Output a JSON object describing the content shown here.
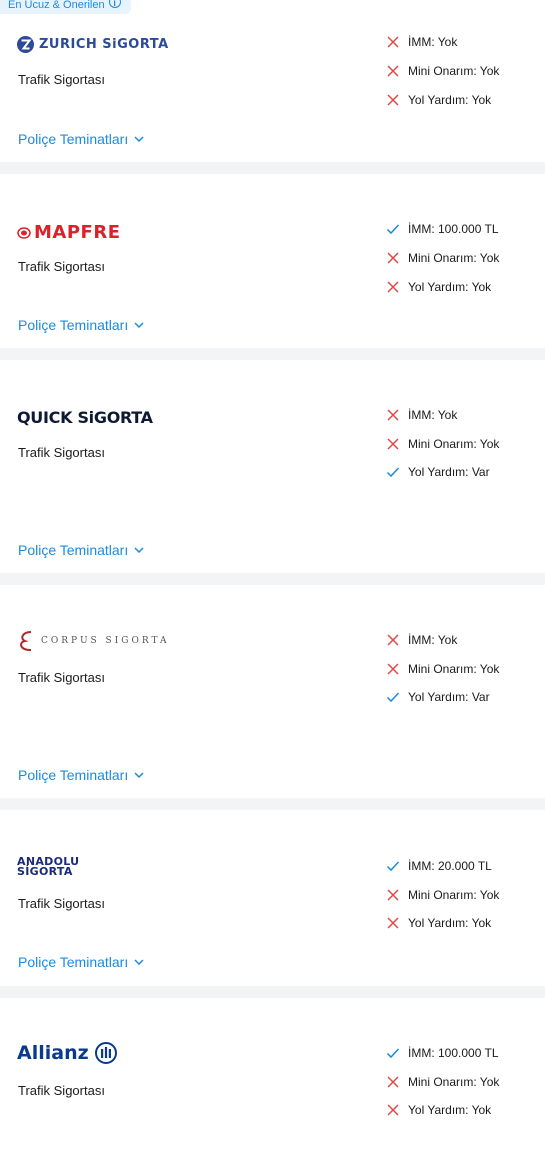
{
  "badge": {
    "label": "En Ucuz & Önerilen",
    "icon": "info-icon"
  },
  "colors": {
    "accent": "#1b8be0",
    "cross": "#e04848",
    "check": "#1b8be0",
    "separator": "#f2f4f5"
  },
  "offers": [
    {
      "company": "ZURICH SiGORTA",
      "product": "Trafik Sigortası",
      "link": "Poliçe Teminatları",
      "coverages": [
        {
          "label": "İMM: Yok",
          "status": "cross"
        },
        {
          "label": "Mini Onarım: Yok",
          "status": "cross"
        },
        {
          "label": "Yol Yardım: Yok",
          "status": "cross"
        }
      ]
    },
    {
      "company": "MAPFRE",
      "product": "Trafik Sigortası",
      "link": "Poliçe Teminatları",
      "coverages": [
        {
          "label": "İMM: 100.000 TL",
          "status": "check"
        },
        {
          "label": "Mini Onarım: Yok",
          "status": "cross"
        },
        {
          "label": "Yol Yardım: Yok",
          "status": "cross"
        }
      ]
    },
    {
      "company": "QUICK SiGORTA",
      "product": "Trafik Sigortası",
      "link": "Poliçe Teminatları",
      "coverages": [
        {
          "label": "İMM: Yok",
          "status": "cross"
        },
        {
          "label": "Mini Onarım: Yok",
          "status": "cross"
        },
        {
          "label": "Yol Yardım: Var",
          "status": "check"
        }
      ]
    },
    {
      "company": "CORPUS SIGORTA",
      "product": "Trafik Sigortası",
      "link": "Poliçe Teminatları",
      "coverages": [
        {
          "label": "İMM: Yok",
          "status": "cross"
        },
        {
          "label": "Mini Onarım: Yok",
          "status": "cross"
        },
        {
          "label": "Yol Yardım: Var",
          "status": "check"
        }
      ]
    },
    {
      "company": "ANADOLU SİGORTA",
      "product": "Trafik Sigortası",
      "link": "Poliçe Teminatları",
      "coverages": [
        {
          "label": "İMM: 20.000 TL",
          "status": "check"
        },
        {
          "label": "Mini Onarım: Yok",
          "status": "cross"
        },
        {
          "label": "Yol Yardım: Yok",
          "status": "cross"
        }
      ]
    },
    {
      "company": "Allianz",
      "product": "Trafik Sigortası",
      "link": "",
      "coverages": [
        {
          "label": "İMM: 100.000 TL",
          "status": "check"
        },
        {
          "label": "Mini Onarım: Yok",
          "status": "cross"
        },
        {
          "label": "Yol Yardım: Yok",
          "status": "cross"
        }
      ]
    }
  ]
}
